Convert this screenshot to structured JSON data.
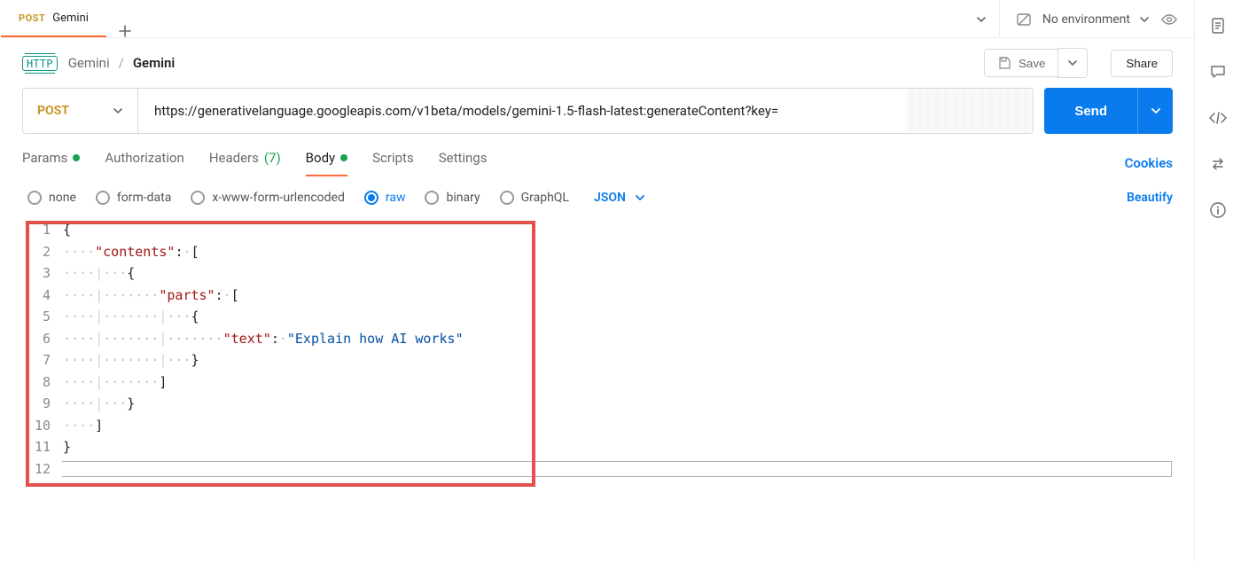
{
  "tabs": {
    "items": [
      {
        "method": "POST",
        "title": "Gemini",
        "active": true
      }
    ],
    "new_tab_tooltip": "New Tab"
  },
  "environment": {
    "selected": "No environment"
  },
  "breadcrumb": {
    "collection": "Gemini",
    "request": "Gemini",
    "http_badge": "HTTP"
  },
  "actions": {
    "save_label": "Save",
    "share_label": "Share"
  },
  "request": {
    "method": "POST",
    "url": "https://generativelanguage.googleapis.com/v1beta/models/gemini-1.5-flash-latest:generateContent?key=",
    "send_label": "Send"
  },
  "request_tabs": {
    "items": [
      {
        "label": "Params",
        "indicator": "green-dot",
        "active": false
      },
      {
        "label": "Authorization",
        "indicator": null,
        "active": false
      },
      {
        "label": "Headers",
        "count_suffix": "(7)",
        "active": false
      },
      {
        "label": "Body",
        "indicator": "green-dot",
        "active": true
      },
      {
        "label": "Scripts",
        "indicator": null,
        "active": false
      },
      {
        "label": "Settings",
        "indicator": null,
        "active": false
      }
    ],
    "cookies_label": "Cookies"
  },
  "body_type": {
    "options": [
      {
        "key": "none",
        "label": "none",
        "selected": false
      },
      {
        "key": "form",
        "label": "form-data",
        "selected": false
      },
      {
        "key": "urlenc",
        "label": "x-www-form-urlencoded",
        "selected": false
      },
      {
        "key": "raw",
        "label": "raw",
        "selected": true
      },
      {
        "key": "binary",
        "label": "binary",
        "selected": false
      },
      {
        "key": "graphql",
        "label": "GraphQL",
        "selected": false
      }
    ],
    "raw_format": "JSON",
    "beautify_label": "Beautify"
  },
  "editor": {
    "line_count": 12,
    "body_json": {
      "contents": [
        {
          "parts": [
            {
              "text": "Explain how AI works"
            }
          ]
        }
      ]
    },
    "tokens": {
      "k_contents": "\"contents\"",
      "k_parts": "\"parts\"",
      "k_text": "\"text\"",
      "v_text": "\"Explain how AI works\""
    }
  }
}
